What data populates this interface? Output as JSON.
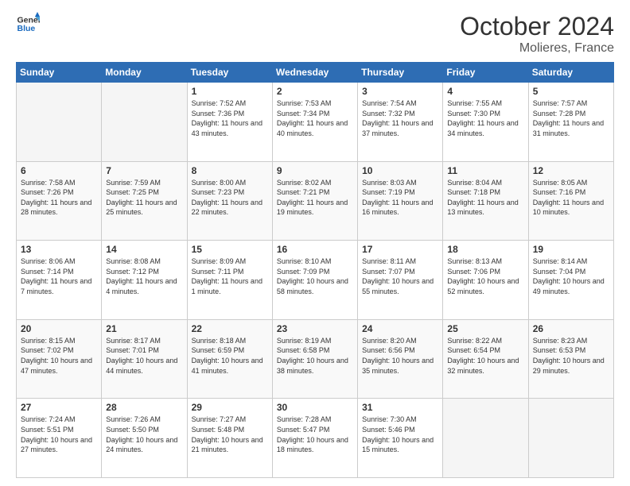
{
  "logo": {
    "line1": "General",
    "line2": "Blue"
  },
  "header": {
    "month": "October 2024",
    "location": "Molieres, France"
  },
  "weekdays": [
    "Sunday",
    "Monday",
    "Tuesday",
    "Wednesday",
    "Thursday",
    "Friday",
    "Saturday"
  ],
  "weeks": [
    [
      {
        "day": null,
        "info": null
      },
      {
        "day": null,
        "info": null
      },
      {
        "day": "1",
        "info": "Sunrise: 7:52 AM\nSunset: 7:36 PM\nDaylight: 11 hours and 43 minutes."
      },
      {
        "day": "2",
        "info": "Sunrise: 7:53 AM\nSunset: 7:34 PM\nDaylight: 11 hours and 40 minutes."
      },
      {
        "day": "3",
        "info": "Sunrise: 7:54 AM\nSunset: 7:32 PM\nDaylight: 11 hours and 37 minutes."
      },
      {
        "day": "4",
        "info": "Sunrise: 7:55 AM\nSunset: 7:30 PM\nDaylight: 11 hours and 34 minutes."
      },
      {
        "day": "5",
        "info": "Sunrise: 7:57 AM\nSunset: 7:28 PM\nDaylight: 11 hours and 31 minutes."
      }
    ],
    [
      {
        "day": "6",
        "info": "Sunrise: 7:58 AM\nSunset: 7:26 PM\nDaylight: 11 hours and 28 minutes."
      },
      {
        "day": "7",
        "info": "Sunrise: 7:59 AM\nSunset: 7:25 PM\nDaylight: 11 hours and 25 minutes."
      },
      {
        "day": "8",
        "info": "Sunrise: 8:00 AM\nSunset: 7:23 PM\nDaylight: 11 hours and 22 minutes."
      },
      {
        "day": "9",
        "info": "Sunrise: 8:02 AM\nSunset: 7:21 PM\nDaylight: 11 hours and 19 minutes."
      },
      {
        "day": "10",
        "info": "Sunrise: 8:03 AM\nSunset: 7:19 PM\nDaylight: 11 hours and 16 minutes."
      },
      {
        "day": "11",
        "info": "Sunrise: 8:04 AM\nSunset: 7:18 PM\nDaylight: 11 hours and 13 minutes."
      },
      {
        "day": "12",
        "info": "Sunrise: 8:05 AM\nSunset: 7:16 PM\nDaylight: 11 hours and 10 minutes."
      }
    ],
    [
      {
        "day": "13",
        "info": "Sunrise: 8:06 AM\nSunset: 7:14 PM\nDaylight: 11 hours and 7 minutes."
      },
      {
        "day": "14",
        "info": "Sunrise: 8:08 AM\nSunset: 7:12 PM\nDaylight: 11 hours and 4 minutes."
      },
      {
        "day": "15",
        "info": "Sunrise: 8:09 AM\nSunset: 7:11 PM\nDaylight: 11 hours and 1 minute."
      },
      {
        "day": "16",
        "info": "Sunrise: 8:10 AM\nSunset: 7:09 PM\nDaylight: 10 hours and 58 minutes."
      },
      {
        "day": "17",
        "info": "Sunrise: 8:11 AM\nSunset: 7:07 PM\nDaylight: 10 hours and 55 minutes."
      },
      {
        "day": "18",
        "info": "Sunrise: 8:13 AM\nSunset: 7:06 PM\nDaylight: 10 hours and 52 minutes."
      },
      {
        "day": "19",
        "info": "Sunrise: 8:14 AM\nSunset: 7:04 PM\nDaylight: 10 hours and 49 minutes."
      }
    ],
    [
      {
        "day": "20",
        "info": "Sunrise: 8:15 AM\nSunset: 7:02 PM\nDaylight: 10 hours and 47 minutes."
      },
      {
        "day": "21",
        "info": "Sunrise: 8:17 AM\nSunset: 7:01 PM\nDaylight: 10 hours and 44 minutes."
      },
      {
        "day": "22",
        "info": "Sunrise: 8:18 AM\nSunset: 6:59 PM\nDaylight: 10 hours and 41 minutes."
      },
      {
        "day": "23",
        "info": "Sunrise: 8:19 AM\nSunset: 6:58 PM\nDaylight: 10 hours and 38 minutes."
      },
      {
        "day": "24",
        "info": "Sunrise: 8:20 AM\nSunset: 6:56 PM\nDaylight: 10 hours and 35 minutes."
      },
      {
        "day": "25",
        "info": "Sunrise: 8:22 AM\nSunset: 6:54 PM\nDaylight: 10 hours and 32 minutes."
      },
      {
        "day": "26",
        "info": "Sunrise: 8:23 AM\nSunset: 6:53 PM\nDaylight: 10 hours and 29 minutes."
      }
    ],
    [
      {
        "day": "27",
        "info": "Sunrise: 7:24 AM\nSunset: 5:51 PM\nDaylight: 10 hours and 27 minutes."
      },
      {
        "day": "28",
        "info": "Sunrise: 7:26 AM\nSunset: 5:50 PM\nDaylight: 10 hours and 24 minutes."
      },
      {
        "day": "29",
        "info": "Sunrise: 7:27 AM\nSunset: 5:48 PM\nDaylight: 10 hours and 21 minutes."
      },
      {
        "day": "30",
        "info": "Sunrise: 7:28 AM\nSunset: 5:47 PM\nDaylight: 10 hours and 18 minutes."
      },
      {
        "day": "31",
        "info": "Sunrise: 7:30 AM\nSunset: 5:46 PM\nDaylight: 10 hours and 15 minutes."
      },
      {
        "day": null,
        "info": null
      },
      {
        "day": null,
        "info": null
      }
    ]
  ]
}
